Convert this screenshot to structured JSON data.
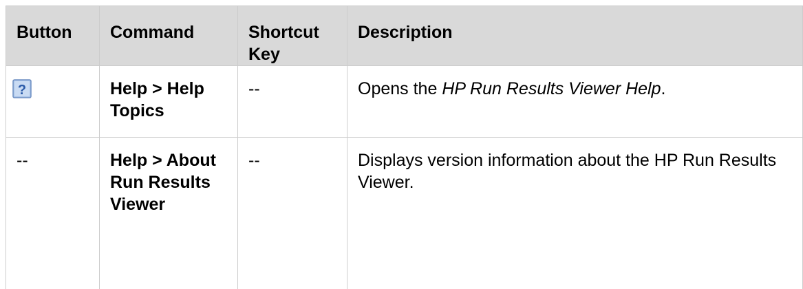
{
  "table": {
    "headers": {
      "button": "Button",
      "command": "Command",
      "shortcut": "Shortcut Key",
      "description": "Description"
    },
    "rows": [
      {
        "button_icon": "help-icon",
        "command": "Help > Help Topics",
        "shortcut": "--",
        "description_prefix": "Opens the ",
        "description_title": "HP Run Results Viewer Help",
        "description_suffix": "."
      },
      {
        "button": "--",
        "command": "Help > About Run Results Viewer",
        "shortcut": "--",
        "description": "Displays version information about the HP Run Results Viewer."
      }
    ]
  },
  "colors": {
    "header_bg": "#d9d9d9",
    "border": "#cccccc",
    "icon_fill": "#a9c3e8",
    "icon_glyph": "#2a5aa8"
  }
}
